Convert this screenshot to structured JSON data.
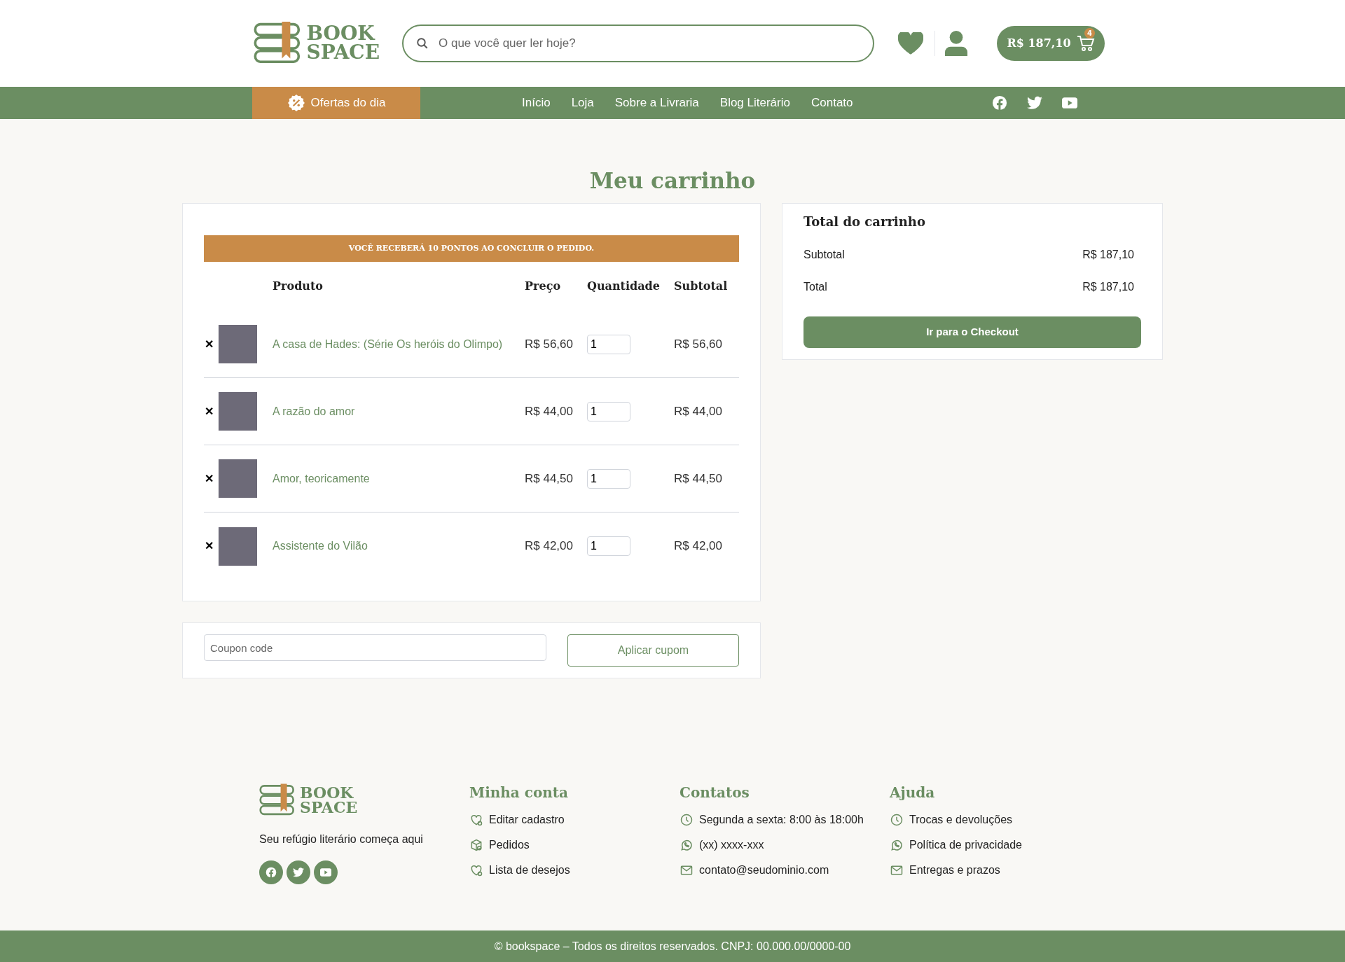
{
  "header": {
    "logo": [
      "BOOK",
      "SPACE"
    ],
    "search": {
      "placeholder": "O que você quer ler hoje?"
    },
    "cart": {
      "total": "R$ 187,10",
      "count": "4"
    }
  },
  "nav": {
    "offers": "Ofertas do dia",
    "links": [
      "Início",
      "Loja",
      "Sobre a Livraria",
      "Blog Literário",
      "Contato"
    ]
  },
  "page_title": "Meu carrinho",
  "cart": {
    "banner": "VOCÊ RECEBERÁ 10 PONTOS AO CONCLUIR O PEDIDO.",
    "remove": "✕",
    "columns": [
      "Produto",
      "Preço",
      "Quantidade",
      "Subtotal"
    ],
    "rows": [
      {
        "product": "A casa de Hades: (Série Os heróis do Olimpo)",
        "price": "R$ 56,60",
        "quantity": "1",
        "subtotal": "R$ 56,60"
      },
      {
        "product": "A razão do amor",
        "price": "R$ 44,00",
        "quantity": "1",
        "subtotal": "R$ 44,00"
      },
      {
        "product": "Amor, teoricamente",
        "price": "R$ 44,50",
        "quantity": "1",
        "subtotal": "R$ 44,50"
      },
      {
        "product": "Assistente do Vilão",
        "price": "R$ 42,00",
        "quantity": "1",
        "subtotal": "R$ 42,00"
      }
    ]
  },
  "coupon": {
    "placeholder": "Coupon code",
    "button": "Aplicar cupom"
  },
  "totals": {
    "title": "Total do carrinho",
    "lines": [
      {
        "label": "Subtotal",
        "value": "R$ 187,10"
      },
      {
        "label": "Total",
        "value": "R$ 187,10"
      }
    ],
    "button": "Ir para o Checkout"
  },
  "footer": {
    "logo": [
      "BOOK",
      "SPACE"
    ],
    "tagline": "Seu refúgio literário começa aqui",
    "columns": [
      {
        "title": "Minha conta",
        "items": [
          {
            "kind": "heart",
            "text": "Editar cadastro"
          },
          {
            "kind": "box",
            "text": "Pedidos"
          },
          {
            "kind": "heart",
            "text": "Lista de desejos"
          }
        ]
      },
      {
        "title": "Contatos",
        "items": [
          {
            "kind": "clock",
            "text": "Segunda a sexta: 8:00 às 18:00h"
          },
          {
            "kind": "whatsapp",
            "text": "(xx) xxxx-xxx"
          },
          {
            "kind": "mail",
            "text": "contato@seudominio.com"
          }
        ]
      },
      {
        "title": "Ajuda",
        "items": [
          {
            "kind": "clock",
            "text": "Trocas e devoluções"
          },
          {
            "kind": "whatsapp",
            "text": "Política de privacidade"
          },
          {
            "kind": "mail",
            "text": "Entregas e prazos"
          }
        ]
      }
    ],
    "copyright": "© bookspace – Todos os direitos reservados. CNPJ: 00.000.00/0000-00"
  }
}
